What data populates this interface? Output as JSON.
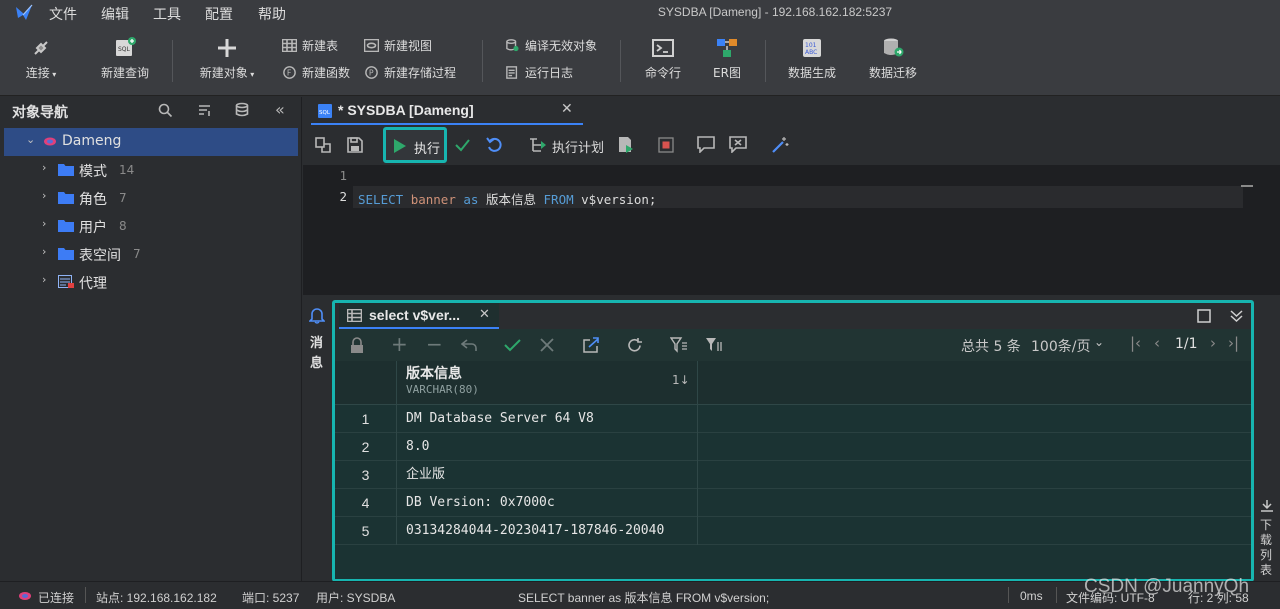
{
  "menubar": {
    "items": [
      "文件",
      "编辑",
      "工具",
      "配置",
      "帮助"
    ],
    "title": "SYSDBA [Dameng]  - 192.168.162.182:5237"
  },
  "toolbar": {
    "connect": "连接",
    "new_query": "新建查询",
    "new_object": "新建对象",
    "new_table": "新建表",
    "new_view": "新建视图",
    "new_function": "新建函数",
    "new_procedure": "新建存储过程",
    "compile_invalid": "编译无效对象",
    "run_log": "运行日志",
    "command_line": "命令行",
    "er_diagram": "ER图",
    "data_generate": "数据生成",
    "data_migrate": "数据迁移"
  },
  "navigator": {
    "title": "对象导航",
    "root": "Dameng",
    "children": [
      {
        "label": "模式",
        "count": "14"
      },
      {
        "label": "角色",
        "count": "7"
      },
      {
        "label": "用户",
        "count": "8"
      },
      {
        "label": "表空间",
        "count": "7"
      },
      {
        "label": "代理",
        "count": ""
      }
    ]
  },
  "editor": {
    "tab_title": "* SYSDBA [Dameng]",
    "execute_label": "执行",
    "explain_label": "执行计划",
    "line_numbers": [
      "1",
      "2"
    ],
    "sql_tokens": {
      "select": "SELECT",
      "col": "banner",
      "as": "as",
      "alias": "版本信息",
      "from": "FROM",
      "table": "v$version;"
    }
  },
  "messages_label": [
    "消",
    "息"
  ],
  "result": {
    "tab_title": "select v$ver...",
    "summary": "总共 5 条",
    "page_size": "100条/页",
    "page": "1/1",
    "column": {
      "name": "版本信息",
      "type": "VARCHAR(80)",
      "sort": "1↓"
    },
    "rows": [
      {
        "n": "1",
        "v": "DM Database Server 64 V8"
      },
      {
        "n": "2",
        "v": "8.0"
      },
      {
        "n": "3",
        "v": "企业版"
      },
      {
        "n": "4",
        "v": "DB Version: 0x7000c"
      },
      {
        "n": "5",
        "v": "03134284044-20230417-187846-20040"
      }
    ]
  },
  "right_side": [
    "下",
    "载",
    "列",
    "表"
  ],
  "status": {
    "connected": "已连接",
    "site": "站点: 192.168.162.182",
    "port": "端口: 5237",
    "user": "用户: SYSDBA",
    "sql": "SELECT banner as 版本信息 FROM v$version;",
    "time": "0ms",
    "encoding": "文件编码: UTF-8",
    "position": "行: 2 列: 58",
    "watermark": "CSDN @JuannyQh"
  },
  "colors": {
    "accent_teal": "#17b5b0",
    "tab_blue": "#3b82f6",
    "keyword": "#569cd6",
    "identifier": "#ce9178",
    "run_green": "#2ea86b"
  }
}
